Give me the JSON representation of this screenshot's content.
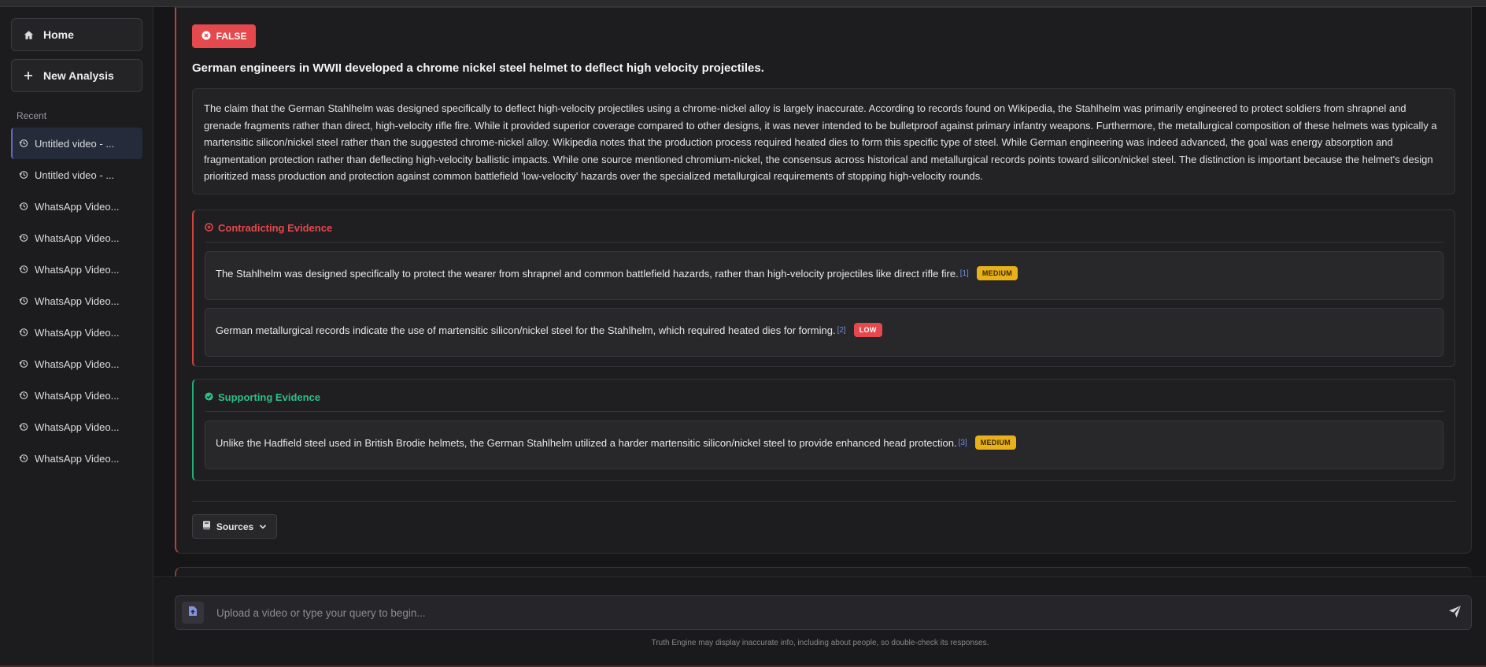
{
  "sidebar": {
    "home_label": "Home",
    "new_analysis_label": "New Analysis",
    "recent_label": "Recent",
    "recent_items": [
      "Untitled video - ...",
      "Untitled video - ...",
      "WhatsApp Video...",
      "WhatsApp Video...",
      "WhatsApp Video...",
      "WhatsApp Video...",
      "WhatsApp Video...",
      "WhatsApp Video...",
      "WhatsApp Video...",
      "WhatsApp Video...",
      "WhatsApp Video..."
    ]
  },
  "result": {
    "verdict": "FALSE",
    "claim": "German engineers in WWII developed a chrome nickel steel helmet to deflect high velocity projectiles.",
    "explanation": "The claim that the German Stahlhelm was designed specifically to deflect high-velocity projectiles using a chrome-nickel alloy is largely inaccurate. According to records found on Wikipedia, the Stahlhelm was primarily engineered to protect soldiers from shrapnel and grenade fragments rather than direct, high-velocity rifle fire. While it provided superior coverage compared to other designs, it was never intended to be bulletproof against primary infantry weapons. Furthermore, the metallurgical composition of these helmets was typically a martensitic silicon/nickel steel rather than the suggested chrome-nickel alloy. Wikipedia notes that the production process required heated dies to form this specific type of steel. While German engineering was indeed advanced, the goal was energy absorption and fragmentation protection rather than deflecting high-velocity ballistic impacts. While one source mentioned chromium-nickel, the consensus across historical and metallurgical records points toward silicon/nickel steel. The distinction is important because the helmet's design prioritized mass production and protection against common battlefield 'low-velocity' hazards over the specialized metallurgical requirements of stopping high-velocity rounds.",
    "contradicting": {
      "title": "Contradicting Evidence",
      "items": [
        {
          "text": "The Stahlhelm was designed specifically to protect the wearer from shrapnel and common battlefield hazards, rather than high-velocity projectiles like direct rifle fire.",
          "cite": "[1]",
          "strength": "MEDIUM"
        },
        {
          "text": "German metallurgical records indicate the use of martensitic silicon/nickel steel for the Stahlhelm, which required heated dies for forming.",
          "cite": "[2]",
          "strength": "LOW"
        }
      ]
    },
    "supporting": {
      "title": "Supporting Evidence",
      "items": [
        {
          "text": "Unlike the Hadfield steel used in British Brodie helmets, the German Stahlhelm utilized a harder martensitic silicon/nickel steel to provide enhanced head protection.",
          "cite": "[3]",
          "strength": "MEDIUM"
        }
      ]
    },
    "sources_label": "Sources"
  },
  "composer": {
    "placeholder": "Upload a video or type your query to begin...",
    "disclaimer": "Truth Engine may display inaccurate info, including about people, so double-check its responses."
  },
  "colors": {
    "false": "#e5484d",
    "contradicting": "#e5484d",
    "supporting": "#2fbf85",
    "medium": "#e8b01a",
    "low": "#e5484d",
    "citation": "#6f8ce6"
  }
}
